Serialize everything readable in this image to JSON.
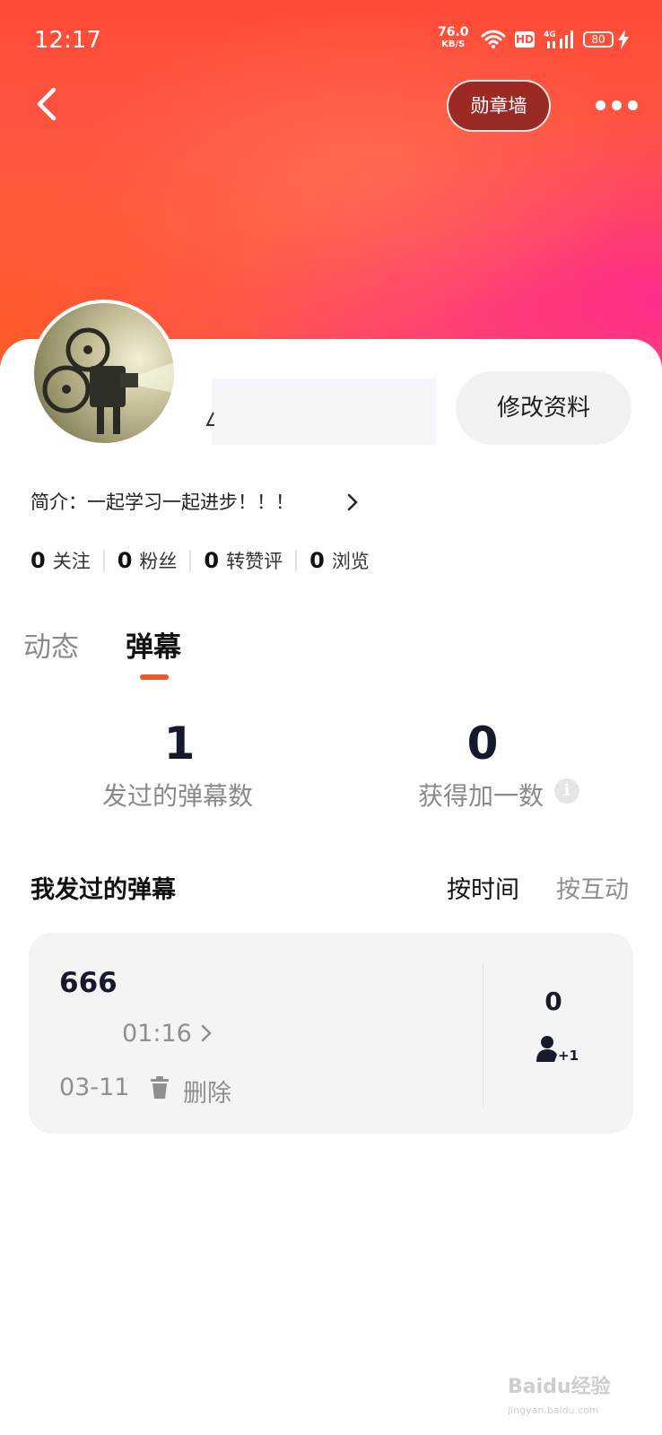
{
  "status_bar": {
    "time": "12:17",
    "net_speed": "76.0",
    "net_speed_unit": "KB/S",
    "hd_label": "HD",
    "network_label": "4G",
    "battery": "80"
  },
  "header": {
    "medal_wall_label": "勋章墙"
  },
  "profile": {
    "edit_label": "修改资料",
    "bio": "简介：一起学习一起进步！！！",
    "stats": [
      {
        "value": "0",
        "label": "关注"
      },
      {
        "value": "0",
        "label": "粉丝"
      },
      {
        "value": "0",
        "label": "转赞评"
      },
      {
        "value": "0",
        "label": "浏览"
      }
    ]
  },
  "tabs": [
    {
      "label": "动态",
      "active": false
    },
    {
      "label": "弹幕",
      "active": true
    }
  ],
  "metrics": {
    "sent_count": "1",
    "sent_label": "发过的弹幕数",
    "plus_count": "0",
    "plus_label": "获得加一数"
  },
  "list": {
    "title": "我发过的弹幕",
    "sort_time": "按时间",
    "sort_interact": "按互动"
  },
  "danmaku_items": [
    {
      "text": "666",
      "video_time": "01:16",
      "date": "03-11",
      "delete_label": "删除",
      "plus_one_count": "0",
      "plus_one_badge": "+1"
    }
  ],
  "watermark": {
    "text": "Baidu经验",
    "sub": "jingyan.baidu.com"
  },
  "colors": {
    "accent": "#f2552a",
    "medal_button": "#9b2a24",
    "header_gradient_start": "#ff4b38",
    "header_gradient_end": "#ff2d8a"
  }
}
